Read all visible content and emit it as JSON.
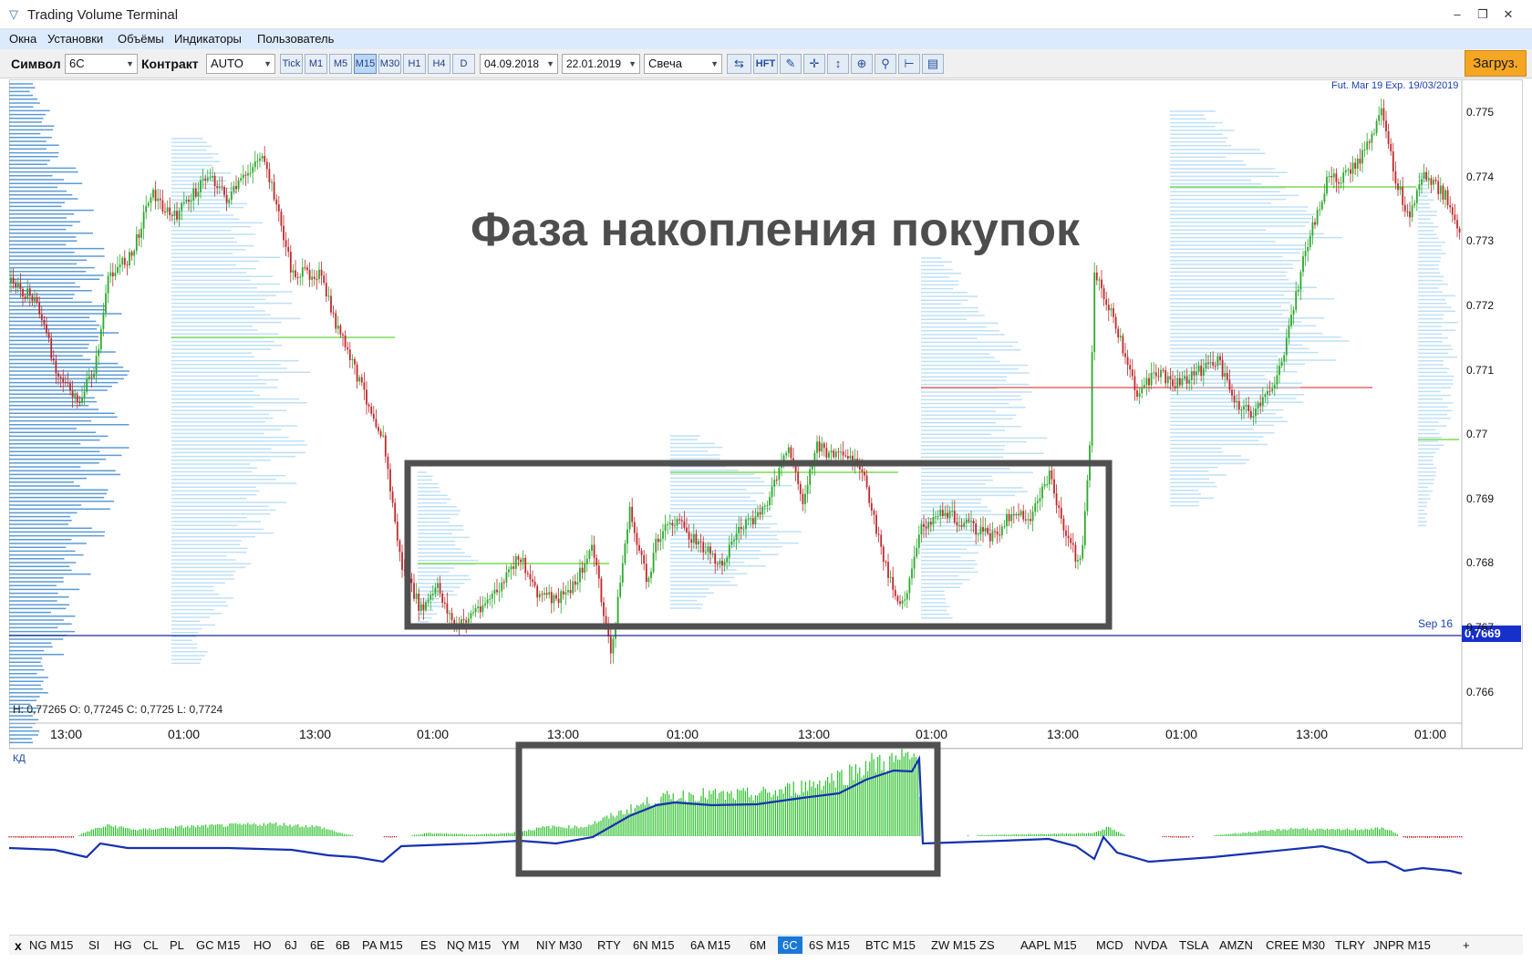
{
  "window": {
    "title": "Trading Volume Terminal",
    "minimize": "‒",
    "restore": "❐",
    "close": "✕"
  },
  "menu": [
    "Окна",
    "Установки",
    "Объёмы",
    "Индикаторы",
    "Пользователь"
  ],
  "toolbar": {
    "symbol_label": "Символ",
    "symbol_value": "6C",
    "contract_label": "Контракт",
    "contract_value": "AUTO",
    "timeframes": [
      "Tick",
      "M1",
      "M5",
      "M15",
      "M30",
      "H1",
      "H4",
      "D"
    ],
    "active_timeframe": "M15",
    "date_from": "04.09.2018",
    "date_to": "22.01.2019",
    "chart_type": "Свеча",
    "hft_label": "HFT",
    "load_button": "Загруз."
  },
  "chart": {
    "contract_info": "Fut. Mar 19 Exp. 19/03/2019",
    "session_label": "Sep 16",
    "current_price": "0,7669",
    "ohlc_readout": "H: 0,77265 O: 0,77245 C: 0,7725 L: 0,7724",
    "annotation": "Фаза накопления покупок",
    "y_ticks": [
      "0.775",
      "0.774",
      "0.773",
      "0.772",
      "0.771",
      "0.77",
      "0.769",
      "0.768",
      "0.767",
      "0.766"
    ],
    "x_ticks": [
      "13:00",
      "01:00",
      "13:00",
      "01:00",
      "13:00",
      "01:00",
      "13:00",
      "01:00",
      "13:00",
      "01:00",
      "13:00",
      "01:00"
    ],
    "colors": {
      "up": "#2ca82c",
      "down": "#c0282b",
      "profile": "#5b9bd5",
      "poc": "#7fdc5a",
      "box": "#505050",
      "price_line": "#1a2a8a"
    }
  },
  "indicator": {
    "label": "КД"
  },
  "symbols": [
    "NG M15",
    "SI",
    "HG",
    "CL",
    "PL",
    "GC M15",
    "HO",
    "6J",
    "6E",
    "6B",
    "PA M15",
    "ES",
    "NQ M15",
    "YM",
    "NIY M30",
    "RTY",
    "6N M15",
    "6A M15",
    "6M",
    "6C",
    "6S M15",
    "BTC M15",
    "ZW M15",
    "ZS",
    "AAPL M15",
    "MCD",
    "NVDA",
    "TSLA",
    "AMZN",
    "CREE M30",
    "TLRY",
    "JNPR M15",
    "+"
  ],
  "active_symbol": "6C",
  "bottom_close": "x"
}
